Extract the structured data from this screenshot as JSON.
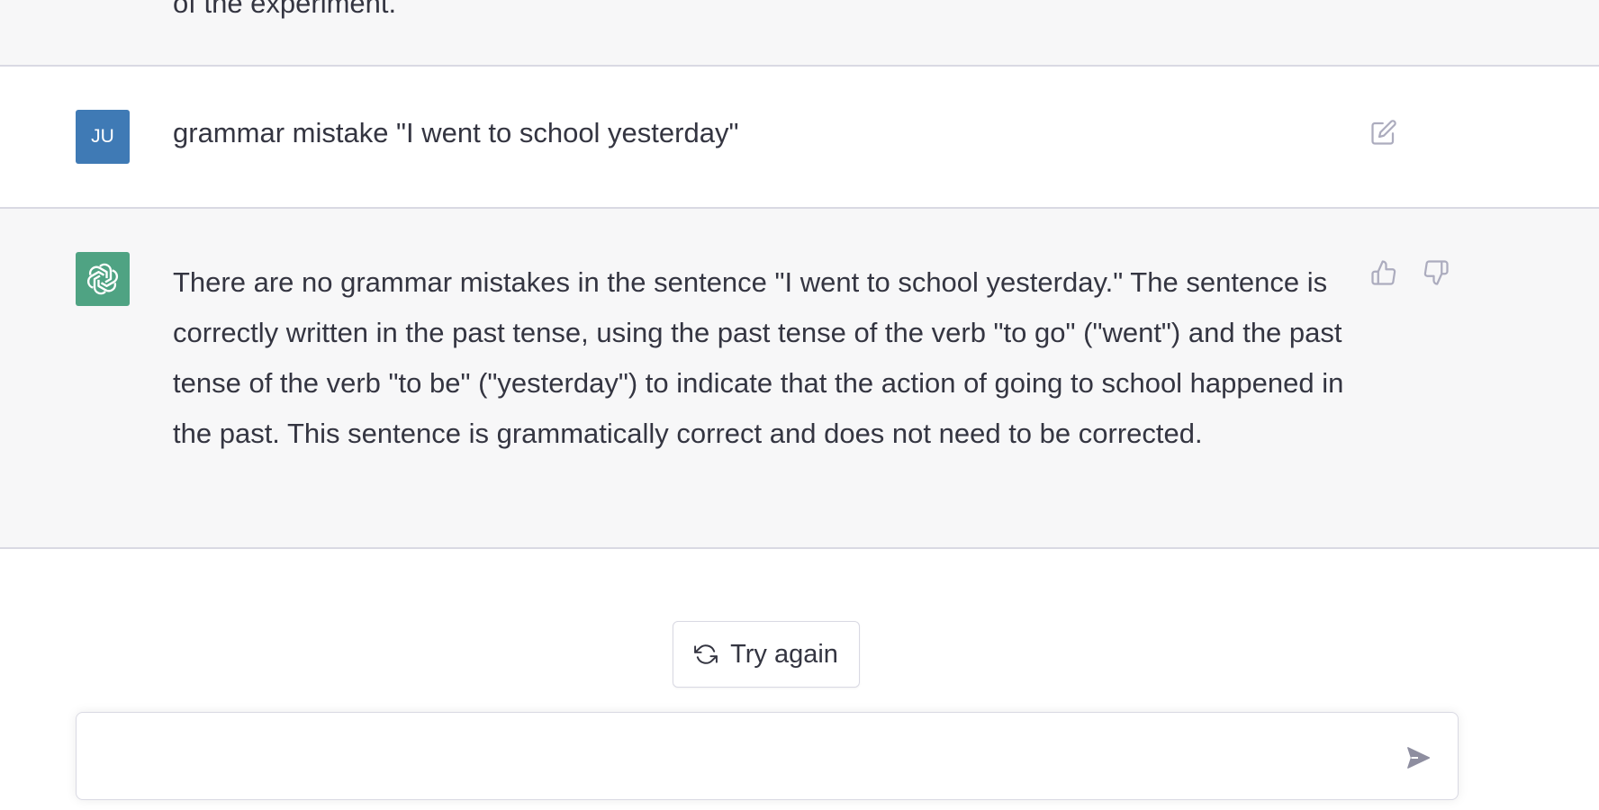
{
  "previous_message": {
    "text_fragment": "of the experiment."
  },
  "user_message": {
    "avatar_initials": "JU",
    "avatar_color": "#3f7ab5",
    "text": "grammar mistake \"I went to school yesterday\"",
    "edit_icon": "edit-icon"
  },
  "assistant_message": {
    "avatar_icon": "openai-logo-icon",
    "avatar_color": "#4fa383",
    "text": "There are no grammar mistakes in the sentence \"I went to school yesterday.\" The sentence is correctly written in the past tense, using the past tense of the verb \"to go\" (\"went\") and the past tense of the verb \"to be\" (\"yesterday\") to indicate that the action of going to school happened in the past. This sentence is grammatically correct and does not need to be corrected.",
    "feedback_icons": [
      "thumbs-up-icon",
      "thumbs-down-icon"
    ]
  },
  "actions": {
    "try_again_label": "Try again",
    "try_again_icon": "refresh-icon"
  },
  "composer": {
    "value": "",
    "placeholder": "",
    "send_icon": "send-icon"
  }
}
